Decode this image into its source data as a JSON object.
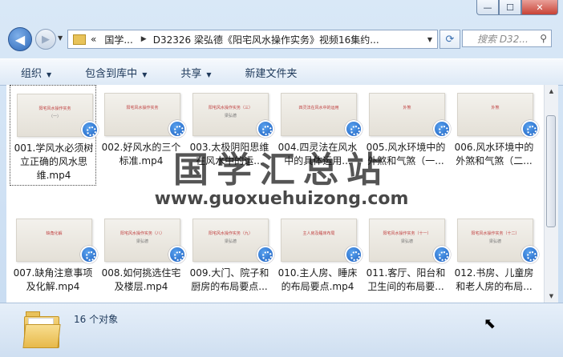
{
  "window": {
    "controls": {
      "minimize": "—",
      "maximize": "☐",
      "close": "✕"
    }
  },
  "nav": {
    "back_icon": "arrow-left-icon",
    "forward_icon": "arrow-right-icon",
    "breadcrumb": [
      "«",
      "国学...",
      "D32326 梁弘德《阳宅风水操作实务》视频16集约..."
    ],
    "search_placeholder": "搜索 D32..."
  },
  "toolbar": {
    "organize": "组织",
    "include_library": "包含到库中",
    "share": "共享",
    "new_folder": "新建文件夹"
  },
  "files": [
    {
      "label": "001.学风水必须树立正确的风水思维.mp4",
      "thumb_title": "阳宅风水操作实务",
      "thumb_sub": "（一）"
    },
    {
      "label": "002.好风水的三个标准.mp4",
      "thumb_title": "阳宅风水操作实务",
      "thumb_sub": ""
    },
    {
      "label": "003.太极阴阳思维在风水中的运...",
      "thumb_title": "阳宅风水操作实务（三）",
      "thumb_sub": "梁弘德"
    },
    {
      "label": "004.四灵法在风水中的具体运用...",
      "thumb_title": "四灵法在风水中的运用",
      "thumb_sub": ""
    },
    {
      "label": "005.风水环境中的外煞和气煞（一...",
      "thumb_title": "外煞",
      "thumb_sub": ""
    },
    {
      "label": "006.风水环境中的外煞和气煞（二...",
      "thumb_title": "外煞",
      "thumb_sub": ""
    },
    {
      "label": "007.缺角注意事项及化解.mp4",
      "thumb_title": "缺角化解",
      "thumb_sub": ""
    },
    {
      "label": "008.如何挑选住宅及楼层.mp4",
      "thumb_title": "阳宅风水操作实务（八）",
      "thumb_sub": "梁弘德"
    },
    {
      "label": "009.大门、院子和厨房的布局要点...",
      "thumb_title": "阳宅风水操作实务（九）",
      "thumb_sub": "梁弘德"
    },
    {
      "label": "010.主人房、睡床的布局要点.mp4",
      "thumb_title": "主人房及睡床布局",
      "thumb_sub": ""
    },
    {
      "label": "011.客厅、阳台和卫生间的布局要...",
      "thumb_title": "阳宅风水操作实务（十一）",
      "thumb_sub": "梁弘德"
    },
    {
      "label": "012.书房、儿童房和老人房的布局...",
      "thumb_title": "阳宅风水操作实务（十二）",
      "thumb_sub": "梁弘德"
    }
  ],
  "status": {
    "count": "16 个对象"
  },
  "watermark": {
    "cn": "国学汇总站",
    "url": "www.guoxuehuizong.com"
  }
}
